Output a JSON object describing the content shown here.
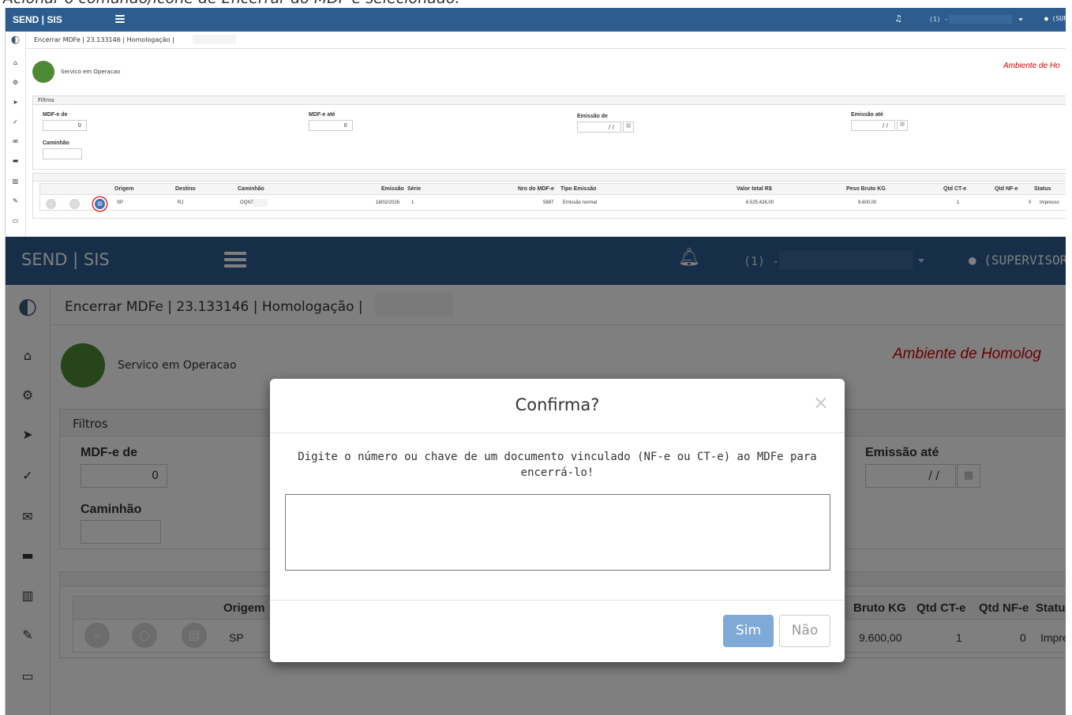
{
  "caption": "Acionar o comando/ícone de Encerrar do MDF-e selecionado:",
  "app": {
    "brand": "SEND | SIS",
    "company_prefix": "(1) -",
    "user_top": "(SUP",
    "user_bottom": "(SUPERVISOR",
    "page_title": "Encerrar MDFe | 23.133146 | Homologação |",
    "status_text": "Servico em Operacao",
    "env_top": "Ambiente de Ho",
    "env_bottom": "Ambiente de Homolog"
  },
  "sidebar": {
    "icons": [
      "logo-icon",
      "home-icon",
      "cogs-icon",
      "send-icon",
      "check-double-icon",
      "envelope-icon",
      "truck-icon",
      "map-icon",
      "wrench-icon",
      "print-icon"
    ]
  },
  "filters": {
    "title": "Filtros",
    "mdfe_de_label": "MDF-e de",
    "mdfe_de_value": "0",
    "mdfe_ate_label": "MDF-e até",
    "mdfe_ate_value": "0",
    "emissao_de_label": "Emissão de",
    "emissao_de_value": "/ /",
    "emissao_ate_label": "Emissão até",
    "emissao_ate_value": "/ /",
    "caminhao_label": "Caminhão"
  },
  "grid": {
    "columns": [
      "Origem",
      "Destino",
      "Caminhão",
      "Emissão",
      "Série",
      "Nro do MDF-e",
      "Tipo Emissão",
      "Valor total R$",
      "Peso Bruto KG",
      "Qtd CT-e",
      "Qtd NF-e",
      "Status"
    ],
    "row": {
      "origem": "SP",
      "destino": "RJ",
      "caminhao": "OQN7",
      "emissao": "18/02/2026",
      "serie": "1",
      "nro": "5887",
      "tipo": "Emissão normal",
      "valor": "6.525.428,00",
      "peso": "9.600,00",
      "qtd_cte": "1",
      "qtd_nfe": "0",
      "status": "Impresso"
    },
    "bottom_headers": {
      "origem": "Origem",
      "peso": "Bruto KG",
      "qtd_cte": "Qtd CT-e",
      "qtd_nfe": "Qtd NF-e",
      "status": "Statu"
    },
    "bottom_row": {
      "origem": "SP",
      "peso": "9.600,00",
      "qtd_cte": "1",
      "qtd_nfe": "0",
      "status": "Impre"
    }
  },
  "modal": {
    "title": "Confirma?",
    "close": "×",
    "message": "Digite o número ou chave de um documento vinculado (NF-e ou CT-e) ao MDFe para encerrá-lo!",
    "input_value": "",
    "yes_label": "Sim",
    "no_label": "Não"
  },
  "colors": {
    "topbar": "#2d5d8f",
    "status_ok": "#4e8a35",
    "environment": "#d00000",
    "primary_button": "#7fa9d6"
  }
}
